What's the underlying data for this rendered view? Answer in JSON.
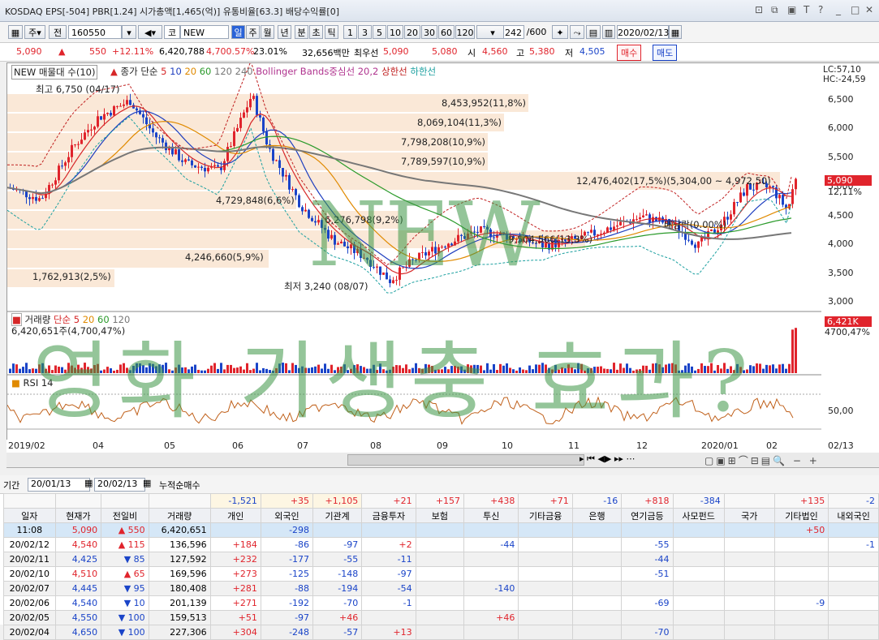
{
  "title": "KOSDAQ EPS[-504] PBR[1.24] 시가총액[1,465(억)] 유통비율[63.3] 배당수익률[0]",
  "window_buttons": [
    "⊡",
    "⧉",
    "▣",
    "T",
    "?",
    "|",
    "_",
    "□",
    "X"
  ],
  "toolbar": {
    "code": "160550",
    "market_label": "코",
    "stock_name": "NEW",
    "periods": [
      "일",
      "주",
      "월",
      "년",
      "분",
      "초",
      "틱"
    ],
    "numbers": [
      "1",
      "3",
      "5",
      "10",
      "20",
      "30",
      "60",
      "120"
    ],
    "count": "242",
    "total": "/600",
    "date": "2020/02/13",
    "misc_labels": [
      "주",
      "전"
    ]
  },
  "quote": {
    "price": "5,090",
    "change": "550",
    "change_pct": "+12.11%",
    "volume": "6,420,788",
    "vol_pct": "4,700.57%",
    "rate": "23.01%",
    "amount": "32,656백만",
    "best_ask_label": "최우선",
    "best_ask": "5,090",
    "best_bid": "5,080",
    "open_label": "시",
    "open": "4,560",
    "high_label": "고",
    "high": "5,380",
    "low_label": "저",
    "low": "4,505",
    "buy": "매수",
    "sell": "매도"
  },
  "chart": {
    "legend_name": "NEW 매물대 수(10)",
    "ma_label": "종가 단순",
    "ma": [
      "5",
      "10",
      "20",
      "60",
      "120",
      "240"
    ],
    "bb_label": "Bollinger Bands중심선 20,2",
    "bb_upper": "상한선",
    "bb_lower": "하한선",
    "lc": "LC:57,10",
    "hc": "HC:-24,59",
    "high_ann": "최고 6,750 (04/17)",
    "low_ann": "최저 3,240 (08/07)",
    "div_ann": "배당락(0.00%)",
    "profile": [
      "8,453,952(11,8%)",
      "8,069,104(11,3%)",
      "7,798,208(10,9%)",
      "7,789,597(10,9%)",
      "12,476,402(17,5%)(5,304,00 ~ 4,972,50)",
      "4,729,848(6,6%)",
      "6,276,798(9,2%)",
      "9,504,566(13,3%)",
      "4,246,660(5,9%)",
      "1,762,913(2,5%)"
    ],
    "y_ticks": [
      "6,500",
      "6,000",
      "5,500",
      "5,000",
      "4,500",
      "4,000",
      "3,500",
      "3,000"
    ],
    "price_tag": "5,090",
    "price_pct": "12,11%",
    "volume_label": "거래량",
    "volume_ma": [
      "단순 5",
      "20",
      "60",
      "120"
    ],
    "volume_value": "6,420,651주(4,700,47%)",
    "volume_tag": "6,421K",
    "volume_tag_pct": "4700,47%",
    "rsi_label": "RSI 14",
    "rsi_tick": "50,00",
    "x_ticks": [
      "2019/02",
      "04",
      "05",
      "06",
      "07",
      "08",
      "09",
      "10",
      "11",
      "12",
      "2020/01",
      "02"
    ],
    "x_end": "02/13"
  },
  "watermark": {
    "line1": "NEW",
    "line2": "영화 기생충 효과?"
  },
  "grid": {
    "period_label": "기간",
    "from": "20/01/13",
    "to": "20/02/13",
    "mode": "누적순매수",
    "totals": [
      "-1,521",
      "+35",
      "+1,105",
      "+21",
      "+157",
      "+438",
      "+71",
      "-16",
      "+818",
      "-384",
      "",
      "+135",
      "-2"
    ],
    "headers": [
      "일자",
      "현재가",
      "전일비",
      "거래량",
      "개인",
      "외국인",
      "기관계",
      "금융투자",
      "보험",
      "투신",
      "기타금융",
      "은행",
      "연기금등",
      "사모펀드",
      "국가",
      "기타법인",
      "내외국인"
    ],
    "rows": [
      [
        "11:08",
        "5,090",
        "550",
        "6,420,651",
        "",
        "-298",
        "",
        "",
        "",
        "",
        "",
        "",
        "",
        "",
        "",
        "+50",
        ""
      ],
      [
        "20/02/12",
        "4,540",
        "115",
        "136,596",
        "+184",
        "-86",
        "-97",
        "+2",
        "",
        "-44",
        "",
        "",
        "-55",
        "",
        "",
        "",
        "-1"
      ],
      [
        "20/02/11",
        "4,425",
        "85",
        "127,592",
        "+232",
        "-177",
        "-55",
        "-11",
        "",
        "",
        "",
        "",
        "-44",
        "",
        "",
        "",
        ""
      ],
      [
        "20/02/10",
        "4,510",
        "65",
        "169,596",
        "+273",
        "-125",
        "-148",
        "-97",
        "",
        "",
        "",
        "",
        "-51",
        "",
        "",
        "",
        ""
      ],
      [
        "20/02/07",
        "4,445",
        "95",
        "180,408",
        "+281",
        "-88",
        "-194",
        "-54",
        "",
        "-140",
        "",
        "",
        "",
        "",
        "",
        "",
        ""
      ],
      [
        "20/02/06",
        "4,540",
        "10",
        "201,139",
        "+271",
        "-192",
        "-70",
        "-1",
        "",
        "",
        "",
        "",
        "-69",
        "",
        "",
        "-9",
        ""
      ],
      [
        "20/02/05",
        "4,550",
        "100",
        "159,513",
        "+51",
        "-97",
        "+46",
        "",
        "",
        "+46",
        "",
        "",
        "",
        "",
        "",
        "",
        ""
      ],
      [
        "20/02/04",
        "4,650",
        "100",
        "227,306",
        "+304",
        "-248",
        "-57",
        "+13",
        "",
        "",
        "",
        "",
        "-70",
        "",
        "",
        "",
        ""
      ]
    ],
    "row_dirs": [
      "up",
      "up",
      "down",
      "up",
      "down",
      "down",
      "down",
      "down"
    ]
  },
  "colors": {
    "up": "#e0242c",
    "down": "#1a44c8",
    "watermark": "#3c9646",
    "ma5": "#d62728",
    "ma10": "#1f3fbf",
    "ma20": "#e08a00",
    "ma60": "#2a9a2a"
  }
}
